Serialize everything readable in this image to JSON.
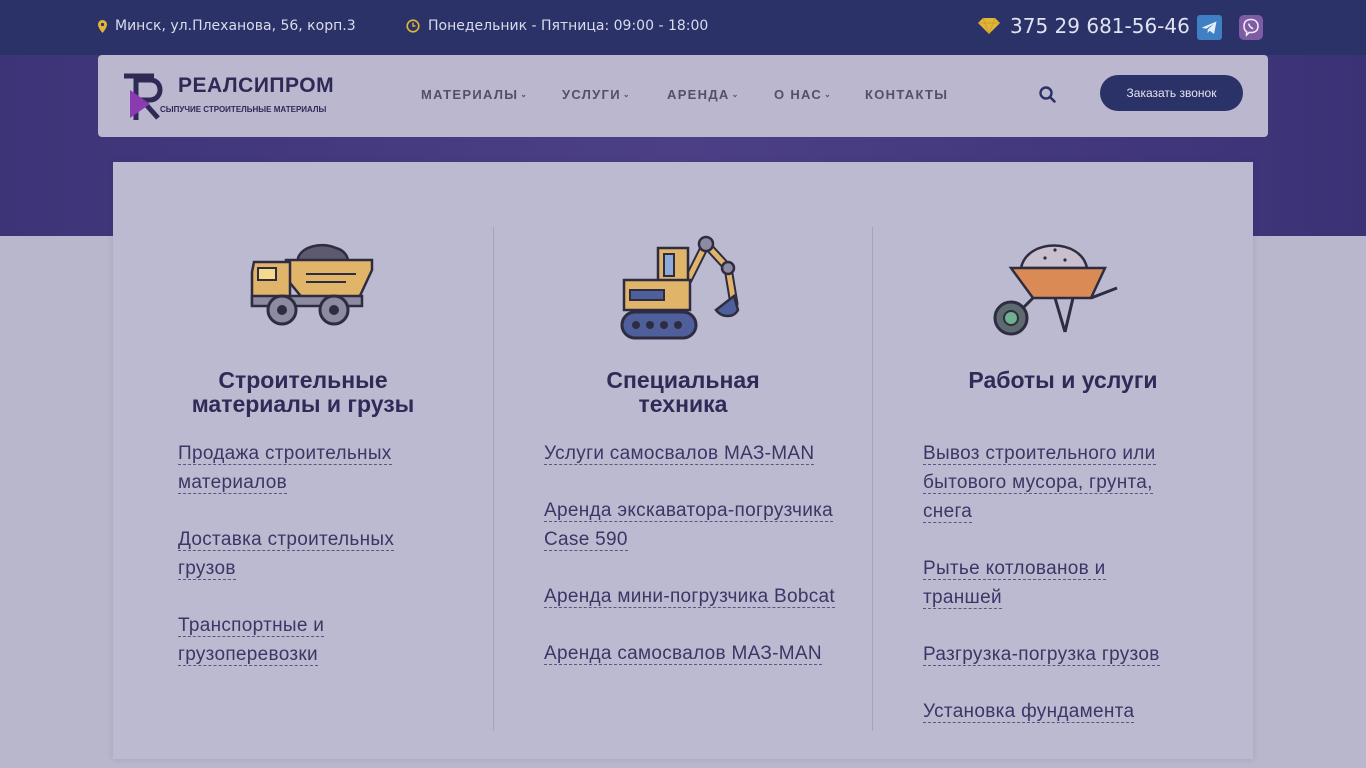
{
  "topbar": {
    "address": "Минск, ул.Плеханова, 56, корп.3",
    "hours": "Понедельник - Пятница:  09:00 - 18:00",
    "phone": "375 29 681-56-46"
  },
  "logo": {
    "title": "РЕАЛСИПРОМ",
    "subtitle": "СЫПУЧИЕ СТРОИТЕЛЬНЫЕ МАТЕРИАЛЫ"
  },
  "nav": {
    "items": [
      "МАТЕРИАЛЫ",
      "УСЛУГИ",
      "АРЕНДА",
      "О НАС",
      "КОНТАКТЫ"
    ],
    "cta": "Заказать звонок"
  },
  "columns": [
    {
      "icon": "dump-truck-icon",
      "title_line1": "Строительные",
      "title_line2": "материалы и грузы",
      "links": [
        "Продажа строительных материалов",
        "Доставка строительных грузов",
        "Транспортные и грузоперевозки"
      ]
    },
    {
      "icon": "excavator-icon",
      "title_line1": "Специальная",
      "title_line2": "техника",
      "links": [
        "Услуги самосвалов МАЗ-MAN",
        "Аренда экскаватора-погрузчика Case 590",
        "Аренда мини-погрузчика Bobcat",
        "Аренда самосвалов МАЗ-MAN"
      ]
    },
    {
      "icon": "wheelbarrow-icon",
      "title_line1": "Работы и услуги",
      "title_line2": "",
      "links": [
        "Вывоз строительного или бытового мусора, грунта, снега",
        "Рытье котлованов и траншей",
        "Разгрузка-погрузка грузов",
        "Установка фундамента"
      ]
    }
  ],
  "colors": {
    "topbar": "#2b3268",
    "accent": "#e0b53a",
    "cta": "#2b3268"
  }
}
